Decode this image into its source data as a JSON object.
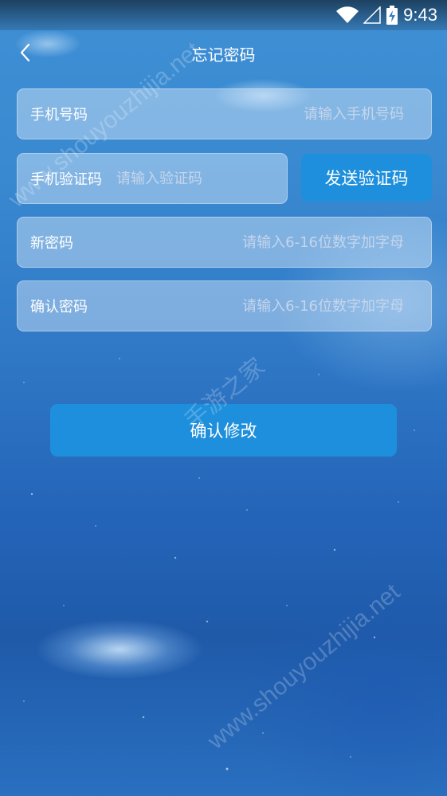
{
  "status_bar": {
    "time": "9:43",
    "icons": [
      "wifi-icon",
      "signal-icon",
      "battery-charging-icon"
    ]
  },
  "header": {
    "back_icon": "chevron-left-icon",
    "title": "忘记密码"
  },
  "form": {
    "phone": {
      "label": "手机号码",
      "placeholder": "请输入手机号码"
    },
    "code": {
      "label": "手机验证码",
      "placeholder": "请输入验证码",
      "send_button_label": "发送验证码"
    },
    "new_password": {
      "label": "新密码",
      "placeholder": "请输入6-16位数字加字母"
    },
    "confirm_password": {
      "label": "确认密码",
      "placeholder": "请输入6-16位数字加字母"
    }
  },
  "actions": {
    "confirm_label": "确认修改"
  },
  "watermarks": {
    "top": "www.shouyouzhijia.net",
    "middle": "手游之家",
    "bottom": "www.shouyouzhijia.net"
  },
  "colors": {
    "button": "#1e8fdc",
    "cursor": "#d2215a"
  }
}
